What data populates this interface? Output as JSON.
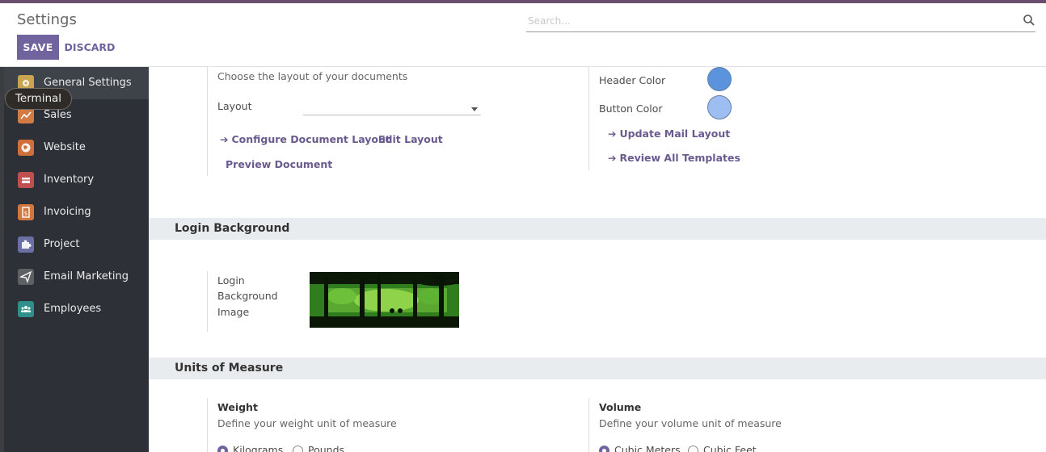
{
  "header": {
    "title": "Settings",
    "save_label": "SAVE",
    "discard_label": "DISCARD",
    "search_placeholder": "Search..."
  },
  "tooltip": "Terminal",
  "sidebar": {
    "items": [
      {
        "label": "General Settings",
        "icon": "general-settings-icon",
        "color": "#c9a34f"
      },
      {
        "label": "Sales",
        "icon": "sales-chart-icon",
        "color": "#d37b42"
      },
      {
        "label": "Website",
        "icon": "website-globe-icon",
        "color": "#d06f3b"
      },
      {
        "label": "Inventory",
        "icon": "inventory-box-icon",
        "color": "#c0504d"
      },
      {
        "label": "Invoicing",
        "icon": "invoicing-icon",
        "color": "#d2783f"
      },
      {
        "label": "Project",
        "icon": "project-puzzle-icon",
        "color": "#6b6fa3"
      },
      {
        "label": "Email Marketing",
        "icon": "email-marketing-icon",
        "color": "#5e6163"
      },
      {
        "label": "Employees",
        "icon": "employees-icon",
        "color": "#2f8f8a"
      }
    ]
  },
  "layout_section": {
    "description": "Choose the layout of your documents",
    "layout_label": "Layout",
    "layout_value": "",
    "configure_link": "Configure Document Layout",
    "edit_link": "Edit Layout",
    "preview_link": "Preview Document",
    "header_color_label": "Header Color",
    "header_color": "#5b93dc",
    "button_color_label": "Button Color",
    "button_color": "#9ebdf0",
    "update_mail_link": "Update Mail Layout",
    "review_templates_link": "Review All Templates"
  },
  "login_section": {
    "title": "Login Background",
    "image_label_lines": [
      "Login",
      "Background",
      "Image"
    ]
  },
  "uom_section": {
    "title": "Units of Measure",
    "weight_title": "Weight",
    "weight_desc": "Define your weight unit of measure",
    "weight_options": [
      "Kilograms",
      "Pounds"
    ],
    "weight_selected": "Kilograms",
    "volume_title": "Volume",
    "volume_desc": "Define your volume unit of measure",
    "volume_options": [
      "Cubic Meters",
      "Cubic Feet"
    ],
    "volume_selected": "Cubic Meters"
  },
  "colors": {
    "accent": "#71639e",
    "sidebar_bg": "#2d3137"
  }
}
